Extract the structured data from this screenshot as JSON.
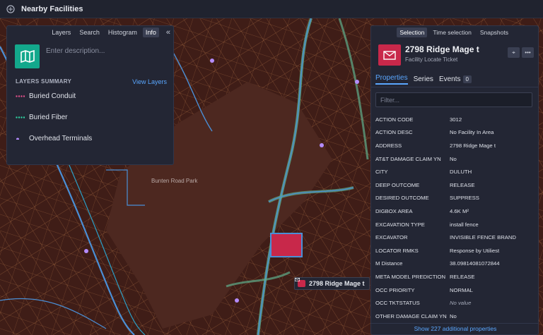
{
  "app": {
    "title": "Nearby Facilities"
  },
  "map": {
    "park_label": "Bunten Road Park",
    "tooltip": "2798 Ridge Mage t"
  },
  "left_panel": {
    "tabs": [
      "Layers",
      "Search",
      "Histogram",
      "Info"
    ],
    "active_tab": "Info",
    "description_placeholder": "Enter description...",
    "summary_title": "LAYERS SUMMARY",
    "view_layers": "View Layers",
    "layers": [
      {
        "name": "Buried Conduit",
        "color": "#e0508a"
      },
      {
        "name": "Buried Fiber",
        "color": "#2fd0a0"
      },
      {
        "name": "Overhead Terminals",
        "color": "#b48cff"
      }
    ]
  },
  "right_panel": {
    "tabs": [
      "Selection",
      "Time selection",
      "Snapshots"
    ],
    "active_tab": "Selection",
    "title": "2798 Ridge Mage t",
    "subtitle": "Facility Locate Ticket",
    "subtabs": [
      "Properties",
      "Series",
      "Events"
    ],
    "events_count": "0",
    "filter_placeholder": "Filter...",
    "properties": [
      {
        "key": "ACTION CODE",
        "value": "3012"
      },
      {
        "key": "ACTION DESC",
        "value": "No Facility In Area"
      },
      {
        "key": "ADDRESS",
        "value": "2798 Ridge Mage t"
      },
      {
        "key": "AT&T DAMAGE CLAIM YN",
        "value": "No"
      },
      {
        "key": "CITY",
        "value": "DULUTH"
      },
      {
        "key": "DEEP OUTCOME",
        "value": "RELEASE"
      },
      {
        "key": "DESIRED OUTCOME",
        "value": "SUPPRESS"
      },
      {
        "key": "DIGBOX AREA",
        "value": "4.6K M²"
      },
      {
        "key": "EXCAVATION TYPE",
        "value": "install fence"
      },
      {
        "key": "EXCAVATOR",
        "value": "INVISIBLE FENCE BRAND"
      },
      {
        "key": "LOCATOR RMKS",
        "value": "Response by Utiliest"
      },
      {
        "key": "M Distance",
        "value": "38.09814081072844"
      },
      {
        "key": "META MODEL PREDICTION",
        "value": "RELEASE"
      },
      {
        "key": "OCC PRIORITY",
        "value": "NORMAL"
      },
      {
        "key": "OCC TKTSTATUS",
        "value": "No value"
      },
      {
        "key": "OTHER DAMAGE CLAIM YN",
        "value": "No"
      }
    ],
    "show_more": "Show 227 additional properties"
  }
}
